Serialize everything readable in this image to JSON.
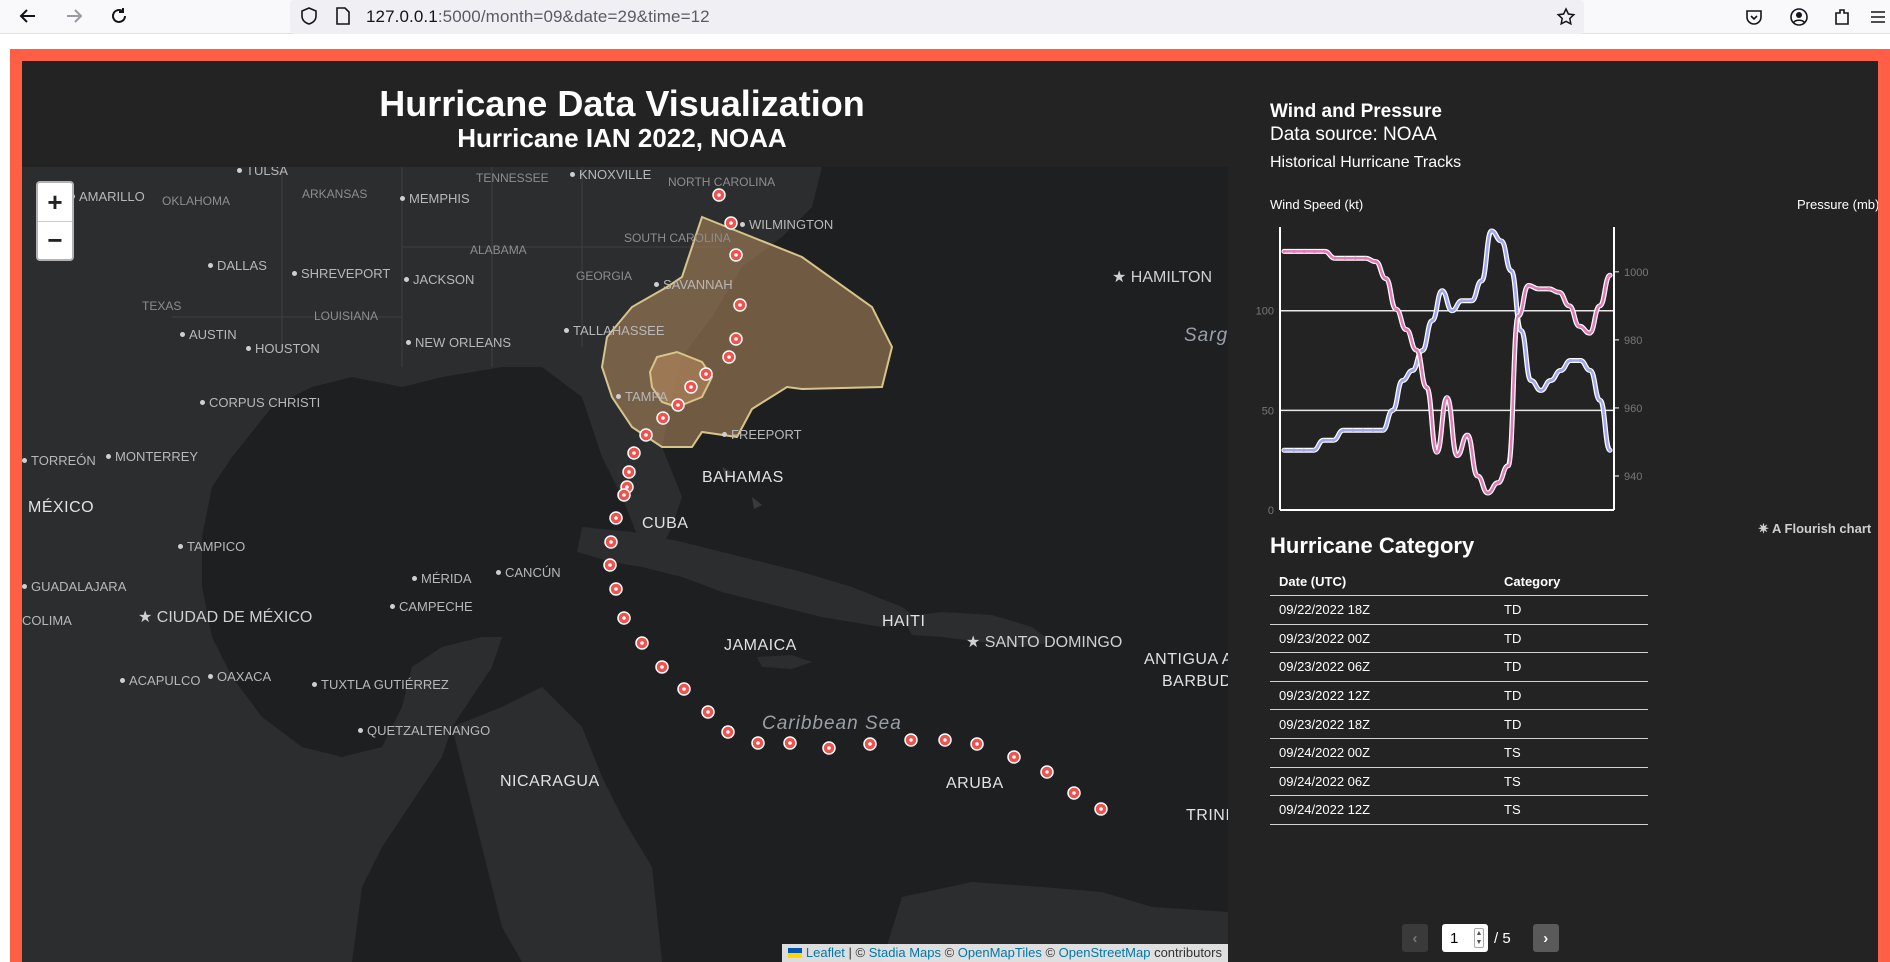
{
  "browser": {
    "url_host": "127.0.0.1",
    "url_rest": ":5000/month=09&date=29&time=12"
  },
  "page": {
    "title": "Hurricane Data Visualization",
    "subtitle": "Hurricane IAN 2022, NOAA"
  },
  "map": {
    "zoom_in": "+",
    "zoom_out": "−",
    "attribution": {
      "leaflet": "Leaflet",
      "sep1": " | © ",
      "stadia": "Stadia Maps",
      "sep2": " © ",
      "omt": "OpenMapTiles",
      "sep3": " © ",
      "osm": "OpenStreetMap",
      "tail": " contributors"
    },
    "labels": {
      "tulsa": "TULSA",
      "amarillo": "AMARILLO",
      "oklahoma": "OKLAHOMA",
      "arkansas": "ARKANSAS",
      "memphis": "MEMPHIS",
      "tennessee": "TENNESSEE",
      "knoxville": "KNOXVILLE",
      "north_carolina": "NORTH CAROLINA",
      "wilmington": "WILMINGTON",
      "south_carolina": "SOUTH CAROLINA",
      "alabama": "ALABAMA",
      "georgia": "GEORGIA",
      "savannah": "SAVANNAH",
      "dallas": "DALLAS",
      "shreveport": "SHREVEPORT",
      "jackson": "JACKSON",
      "texas": "TEXAS",
      "louisiana": "LOUISIANA",
      "tallahassee": "TALLAHASSEE",
      "austin": "AUSTIN",
      "houston": "HOUSTON",
      "new_orleans": "NEW ORLEANS",
      "corpus_christi": "CORPUS CHRISTI",
      "tampa": "TAMPA",
      "freeport": "FREEPORT",
      "bahamas": "BAHAMAS",
      "torreon": "TORREÓN",
      "monterrey": "MONTERREY",
      "mexico": "MÉXICO",
      "cuba": "CUBA",
      "tampico": "TAMPICO",
      "merida": "MÉRIDA",
      "cancun": "CANCÚN",
      "guadalajara": "GUADALAJARA",
      "campeche": "CAMPECHE",
      "colima": "COLIMA",
      "ciudad_mexico": "CIUDAD DE MÉXICO",
      "haiti": "HAITI",
      "santo_domingo": "SANTO DOMINGO",
      "jamaica": "JAMAICA",
      "antigua": "ANTIGUA A",
      "barbuda": "BARBUD",
      "acapulco": "ACAPULCO",
      "oaxaca": "OAXACA",
      "tuxtla": "TUXTLA GUTIÉRREZ",
      "quetzaltenango": "QUETZALTENANGO",
      "caribbean": "Caribbean Sea",
      "nicaragua": "NICARAGUA",
      "aruba": "ARUBA",
      "trini": "TRINI",
      "hamilton": "HAMILTON",
      "sarg": "Sarg"
    }
  },
  "panel": {
    "title": "Wind and Pressure",
    "source": "Data source: NOAA",
    "subtitle": "Historical Hurricane Tracks",
    "left_axis_label": "Wind Speed (kt)",
    "right_axis_label": "Pressure (mb)",
    "flourish": "A Flourish chart",
    "category_title": "Hurricane Category",
    "table": {
      "headers": [
        "Date (UTC)",
        "Category"
      ],
      "rows": [
        [
          "09/22/2022 18Z",
          "TD"
        ],
        [
          "09/23/2022 00Z",
          "TD"
        ],
        [
          "09/23/2022 06Z",
          "TD"
        ],
        [
          "09/23/2022 12Z",
          "TD"
        ],
        [
          "09/23/2022 18Z",
          "TD"
        ],
        [
          "09/24/2022 00Z",
          "TS"
        ],
        [
          "09/24/2022 06Z",
          "TS"
        ],
        [
          "09/24/2022 12Z",
          "TS"
        ]
      ]
    },
    "pager": {
      "prev": "‹",
      "page": "1",
      "total": "/ 5",
      "next": "›"
    }
  },
  "chart_data": {
    "type": "line",
    "xlabel": "",
    "ylabel": "Wind Speed (kt)",
    "y2label": "Pressure (mb)",
    "ylim": [
      0,
      140
    ],
    "y2lim": [
      930,
      1012
    ],
    "y_ticks": [
      0,
      50,
      100
    ],
    "y2_ticks": [
      940,
      960,
      980,
      1000
    ],
    "grid": true,
    "series": [
      {
        "color": "#9fa6f5",
        "axis": "left",
        "values": [
          30,
          30,
          30,
          30,
          35,
          35,
          40,
          40,
          40,
          40,
          40,
          50,
          65,
          70,
          80,
          95,
          110,
          100,
          105,
          105,
          115,
          140,
          135,
          120,
          90,
          65,
          60,
          65,
          70,
          75,
          75,
          70,
          55,
          30
        ]
      },
      {
        "color": "#e37ab6",
        "axis": "right",
        "values": [
          1006,
          1006,
          1006,
          1006,
          1006,
          1004,
          1004,
          1004,
          1004,
          1003,
          998,
          989,
          983,
          977,
          966,
          947,
          963,
          946,
          952,
          940,
          935,
          938,
          943,
          987,
          996,
          995,
          995,
          994,
          990,
          984,
          982,
          990,
          999
        ]
      }
    ]
  }
}
